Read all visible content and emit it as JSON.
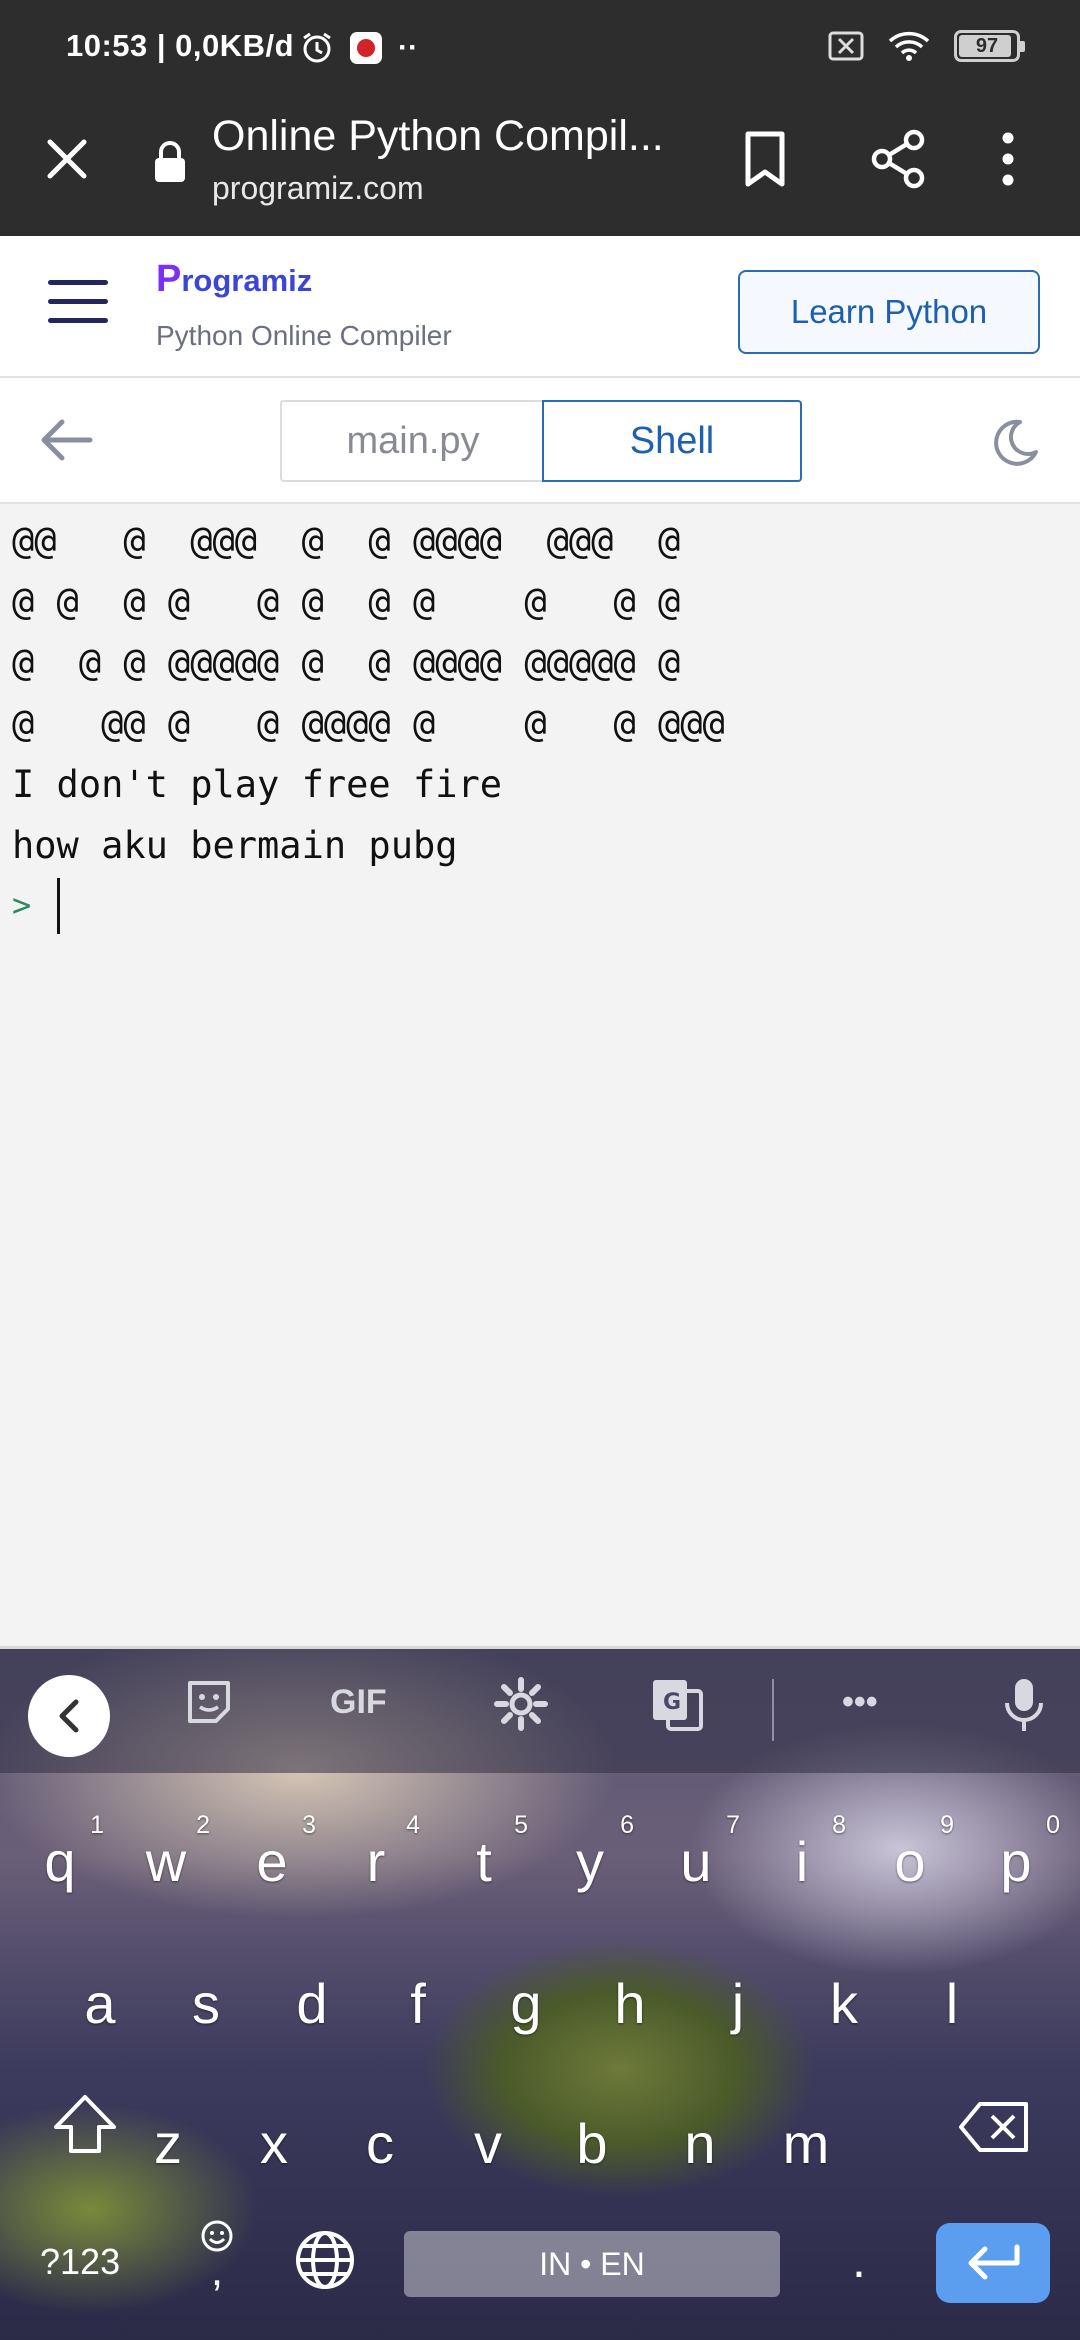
{
  "status_bar": {
    "time_data": "10:53 | 0,0KB/d",
    "battery": "97"
  },
  "browser": {
    "title": "Online Python Compil...",
    "url": "programiz.com"
  },
  "site": {
    "logo": "rogramiz",
    "logo_letter": "P",
    "subtitle": "Python Online Compiler",
    "learn_button": "Learn Python"
  },
  "toolbar": {
    "tabs": [
      {
        "label": "main.py",
        "active": false
      },
      {
        "label": "Shell",
        "active": true
      }
    ]
  },
  "console": {
    "lines": [
      "@@   @  @@@  @  @ @@@@  @@@  @",
      "@ @  @ @   @ @  @ @    @   @ @",
      "@  @ @ @@@@@ @  @ @@@@ @@@@@ @",
      "@   @@ @   @ @@@@ @    @   @ @@@",
      "I don't play free fire",
      "how aku bermain pubg"
    ],
    "prompt": ">"
  },
  "keyboard": {
    "gif_label": "GIF",
    "more_label": "•••",
    "row1": [
      {
        "k": "q",
        "h": "1"
      },
      {
        "k": "w",
        "h": "2"
      },
      {
        "k": "e",
        "h": "3"
      },
      {
        "k": "r",
        "h": "4"
      },
      {
        "k": "t",
        "h": "5"
      },
      {
        "k": "y",
        "h": "6"
      },
      {
        "k": "u",
        "h": "7"
      },
      {
        "k": "i",
        "h": "8"
      },
      {
        "k": "o",
        "h": "9"
      },
      {
        "k": "p",
        "h": "0"
      }
    ],
    "row2": [
      "a",
      "s",
      "d",
      "f",
      "g",
      "h",
      "j",
      "k",
      "l"
    ],
    "row3": [
      "z",
      "x",
      "c",
      "v",
      "b",
      "n",
      "m"
    ],
    "symbols_label": "?123",
    "comma_label": ",",
    "space_label": "IN • EN",
    "period_label": "."
  }
}
